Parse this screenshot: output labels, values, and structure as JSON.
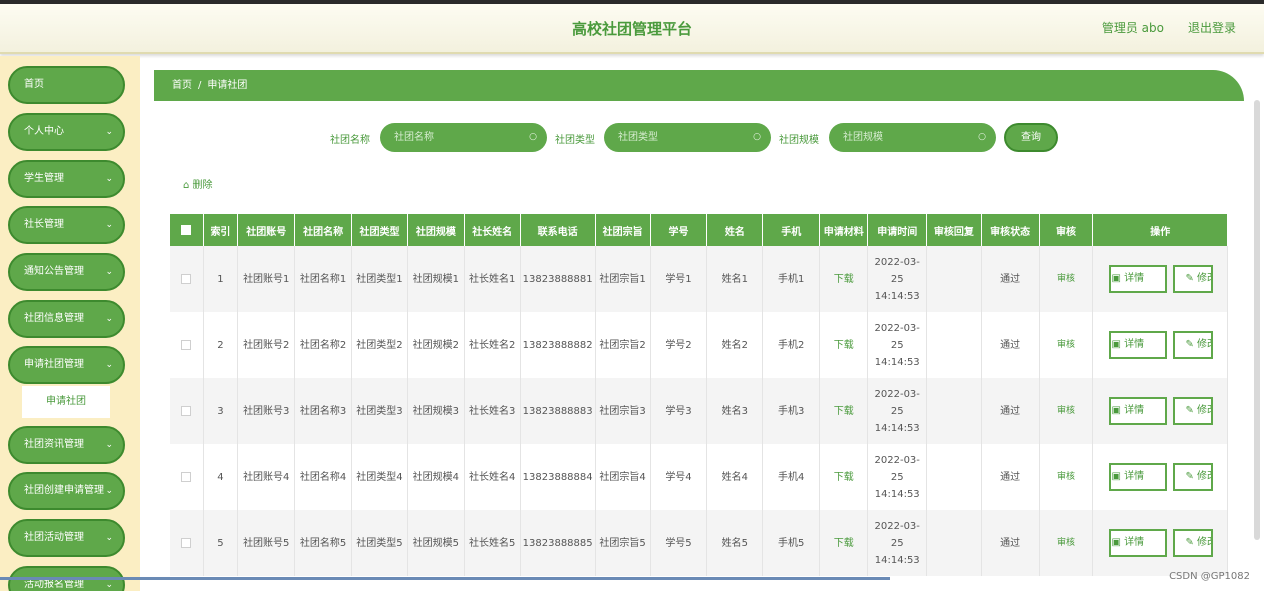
{
  "header": {
    "title": "高校社团管理平台",
    "user": "管理员 abo",
    "logout": "退出登录"
  },
  "sidebar": {
    "items": [
      {
        "label": "首页",
        "chevron": ""
      },
      {
        "label": "个人中心",
        "chevron": "⌄"
      },
      {
        "label": "学生管理",
        "chevron": "⌄"
      },
      {
        "label": "社长管理",
        "chevron": "⌄"
      },
      {
        "label": "通知公告管理",
        "chevron": "⌄"
      },
      {
        "label": "社团信息管理",
        "chevron": "⌄"
      },
      {
        "label": "申请社团管理",
        "chevron": "⌄"
      },
      {
        "label": "社团资讯管理",
        "chevron": "⌄"
      },
      {
        "label": "社团创建申请管理",
        "chevron": "⌄"
      },
      {
        "label": "社团活动管理",
        "chevron": "⌄"
      },
      {
        "label": "活动报名管理",
        "chevron": "⌄"
      }
    ],
    "submenu": "申请社团"
  },
  "breadcrumb": {
    "home": "首页",
    "sep": "/",
    "current": "申请社团"
  },
  "search": {
    "fields": [
      {
        "label": "社团名称",
        "placeholder": "社团名称"
      },
      {
        "label": "社团类型",
        "placeholder": "社团类型"
      },
      {
        "label": "社团规模",
        "placeholder": "社团规模"
      }
    ],
    "query": "查询",
    "search_icon": "○"
  },
  "actions": {
    "delete": "删除",
    "delete_icon": "⌂"
  },
  "table": {
    "headers": [
      "索引",
      "社团账号",
      "社团名称",
      "社团类型",
      "社团规模",
      "社长姓名",
      "联系电话",
      "社团宗旨",
      "学号",
      "姓名",
      "手机",
      "申请材料",
      "申请时间",
      "审核回复",
      "审核状态",
      "审核",
      "操作"
    ],
    "rows": [
      {
        "idx": "1",
        "acct": "社团账号1",
        "name": "社团名称1",
        "type": "社团类型1",
        "scale": "社团规模1",
        "leader": "社长姓名1",
        "phone": "13823888881",
        "purpose": "社团宗旨1",
        "sid": "学号1",
        "sname": "姓名1",
        "mobile": "手机1",
        "material": "下载",
        "time": "2022-03-25 14:14:53",
        "reply": "",
        "status": "通过",
        "audit": "审核",
        "detail": "详情",
        "edit": "修改"
      },
      {
        "idx": "2",
        "acct": "社团账号2",
        "name": "社团名称2",
        "type": "社团类型2",
        "scale": "社团规模2",
        "leader": "社长姓名2",
        "phone": "13823888882",
        "purpose": "社团宗旨2",
        "sid": "学号2",
        "sname": "姓名2",
        "mobile": "手机2",
        "material": "下载",
        "time": "2022-03-25 14:14:53",
        "reply": "",
        "status": "通过",
        "audit": "审核",
        "detail": "详情",
        "edit": "修改"
      },
      {
        "idx": "3",
        "acct": "社团账号3",
        "name": "社团名称3",
        "type": "社团类型3",
        "scale": "社团规模3",
        "leader": "社长姓名3",
        "phone": "13823888883",
        "purpose": "社团宗旨3",
        "sid": "学号3",
        "sname": "姓名3",
        "mobile": "手机3",
        "material": "下载",
        "time": "2022-03-25 14:14:53",
        "reply": "",
        "status": "通过",
        "audit": "审核",
        "detail": "详情",
        "edit": "修改"
      },
      {
        "idx": "4",
        "acct": "社团账号4",
        "name": "社团名称4",
        "type": "社团类型4",
        "scale": "社团规模4",
        "leader": "社长姓名4",
        "phone": "13823888884",
        "purpose": "社团宗旨4",
        "sid": "学号4",
        "sname": "姓名4",
        "mobile": "手机4",
        "material": "下载",
        "time": "2022-03-25 14:14:53",
        "reply": "",
        "status": "通过",
        "audit": "审核",
        "detail": "详情",
        "edit": "修改"
      },
      {
        "idx": "5",
        "acct": "社团账号5",
        "name": "社团名称5",
        "type": "社团类型5",
        "scale": "社团规模5",
        "leader": "社长姓名5",
        "phone": "13823888885",
        "purpose": "社团宗旨5",
        "sid": "学号5",
        "sname": "姓名5",
        "mobile": "手机5",
        "material": "下载",
        "time": "2022-03-25 14:14:53",
        "reply": "",
        "status": "通过",
        "audit": "审核",
        "detail": "详情",
        "edit": "修改"
      }
    ]
  },
  "watermark": "CSDN @GP1082"
}
